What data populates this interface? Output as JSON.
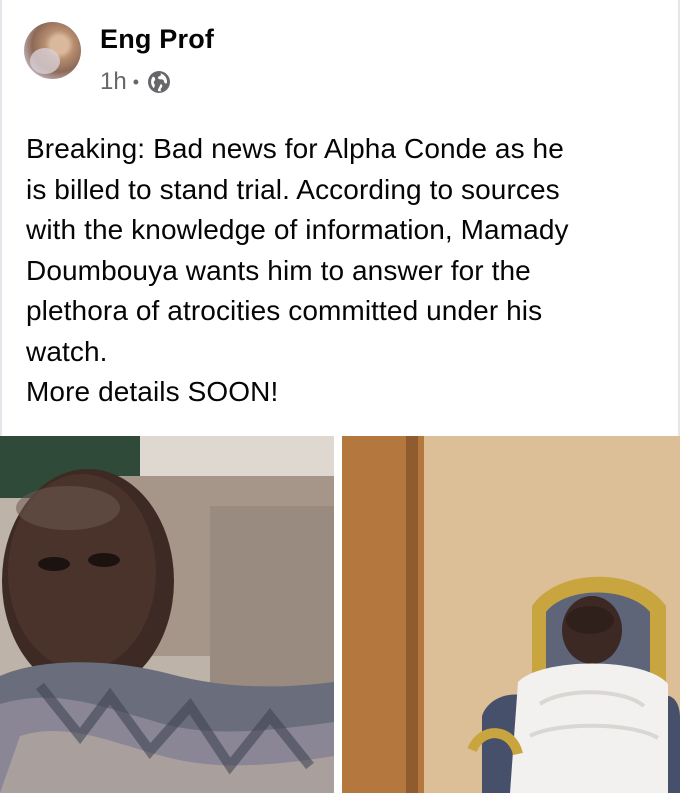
{
  "post": {
    "author": "Eng Prof",
    "time": "1h",
    "separator": "•",
    "privacy_icon": "globe-icon",
    "text_lines": [
      "Breaking: Bad news for Alpha Conde as he",
      "is billed to stand trial. According to sources",
      "with the knowledge of information, Mamady",
      "Doumbouya wants him to answer for the",
      "plethora of atrocities committed under his",
      "watch.",
      "More details SOON!"
    ]
  },
  "colors": {
    "name_text": "#050505",
    "meta_text": "#65676b",
    "border": "#e4e6eb"
  }
}
